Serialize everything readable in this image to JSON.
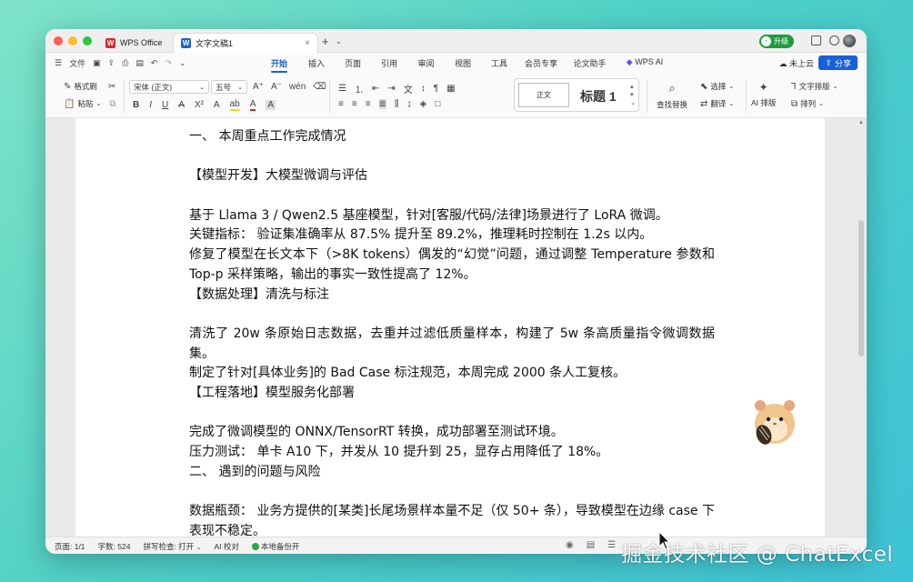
{
  "titlebar": {
    "tabs": [
      {
        "label": "WPS Office"
      },
      {
        "label": "文字文稿1"
      }
    ],
    "upgrade_label": "升级"
  },
  "menubar": {
    "file_label": "文件",
    "items": [
      "开始",
      "插入",
      "页面",
      "引用",
      "审阅",
      "视图",
      "工具",
      "会员专享",
      "论文助手",
      "WPS AI"
    ],
    "active": "开始",
    "cloud_label": "未上云",
    "share_label": "分享"
  },
  "ribbon": {
    "format_painter": "格式刷",
    "paste": "粘贴",
    "font_name": "宋体 (正文)",
    "font_size": "五号",
    "style_normal": "正文",
    "style_h1": "标题 1",
    "find_replace": "查找替换",
    "select": "选择",
    "translate": "翻译",
    "ai_layout": "AI 排版",
    "text_layout": "文字排版",
    "arrange": "排列"
  },
  "document": {
    "paragraphs": [
      {
        "text": "一、  本周重点工作完成情况"
      },
      {
        "text": ""
      },
      {
        "text": "【模型开发】大模型微调与评估"
      },
      {
        "text": ""
      },
      {
        "text": "基于 Llama 3 / Qwen2.5 基座模型，针对[客服/代码/法律]场景进行了 LoRA 微调。"
      },
      {
        "text": "关键指标： 验证集准确率从 87.5% 提升至 89.2%，推理耗时控制在 1.2s 以内。"
      },
      {
        "text": "修复了模型在长文本下（>8K tokens）偶发的“幻觉”问题，通过调整 Temperature 参数和 Top-p 采样策略，输出的事实一致性提高了 12%。"
      },
      {
        "text": "【数据处理】清洗与标注"
      },
      {
        "text": ""
      },
      {
        "text": "清洗了 20w 条原始日志数据，去重并过滤低质量样本，构建了 5w 条高质量指令微调数据集。"
      },
      {
        "text": "制定了针对[具体业务]的 Bad Case 标注规范，本周完成 2000 条人工复核。"
      },
      {
        "text": "【工程落地】模型服务化部署"
      },
      {
        "text": ""
      },
      {
        "text": "完成了微调模型的 ONNX/TensorRT 转换，成功部署至测试环境。"
      },
      {
        "text": "压力测试： 单卡 A10 下，并发从 10 提升到 25，显存占用降低了 18%。"
      },
      {
        "text": "二、  遇到的问题与风险"
      },
      {
        "text": ""
      },
      {
        "text": "数据瓶颈： 业务方提供的[某类]长尾场景样本量不足（仅 50+ 条），导致模型在边缘 case 下表现不稳定。"
      }
    ]
  },
  "statusbar": {
    "page": "页面: 1/1",
    "words": "字数: 524",
    "spellcheck": "拼写检查: 打开",
    "ai_proofread": "AI 校对",
    "backup": "本地备份开"
  },
  "watermark": "掘金技术社区 @ ChatExcel",
  "colors": {
    "accent": "#1a5fd6",
    "upgrade": "#1f9d3c",
    "wps_red": "#e0262b"
  }
}
